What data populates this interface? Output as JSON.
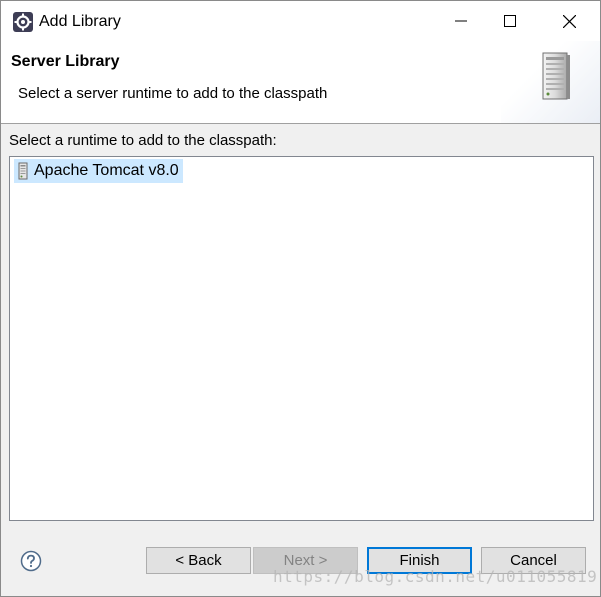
{
  "window": {
    "title": "Add Library",
    "icon": "eclipse-gear-icon",
    "controls": [
      "minimize-icon",
      "maximize-icon",
      "close-icon"
    ]
  },
  "banner": {
    "title": "Server Library",
    "description": "Select a server runtime to add to the classpath",
    "icon": "server-icon"
  },
  "runtimes": {
    "label": "Select a runtime to add to the classpath:",
    "items": [
      {
        "label": "Apache Tomcat v8.0",
        "icon": "server-runtime-icon",
        "selected": true
      }
    ]
  },
  "footer": {
    "help_icon": "question-icon",
    "back_label": "< Back",
    "next_label": "Next >",
    "next_enabled": false,
    "finish_label": "Finish",
    "cancel_label": "Cancel",
    "watermark": "https://blog.csdn.net/u011055819"
  },
  "colors": {
    "selection": "#cce8ff",
    "default_button_border": "#0078d7",
    "dialog_background": "#f0f0f0"
  }
}
